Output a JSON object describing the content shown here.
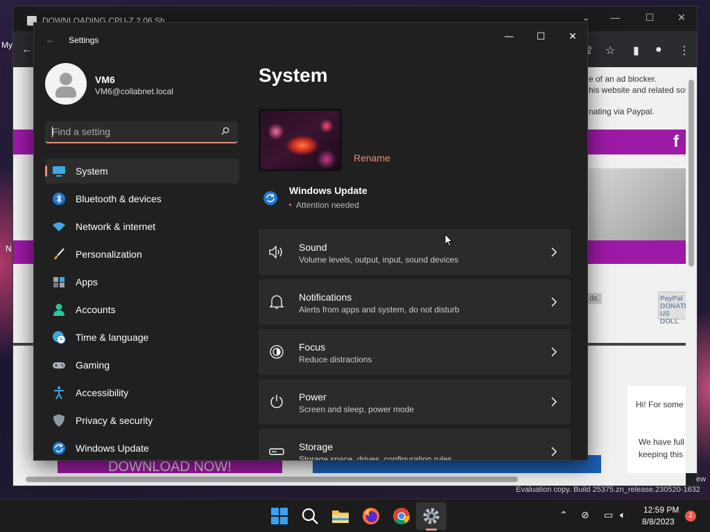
{
  "desktop": {
    "labels": [
      "My",
      "N"
    ]
  },
  "browser": {
    "tab_title": "DOWNLOADING CPU-Z 2.06 Sh...",
    "page_texts": [
      "e of an ad blocker.",
      "his website and related sof",
      "nating via Paypal.",
      "ds.",
      "Hi! For some",
      "We have full",
      "keeping this",
      "DOWNLOAD NOW!",
      "PayPal DONATE US DOLL"
    ],
    "facebook_letter": "f",
    "evaluation_text": "Evaluation copy. Build 25375.zn_release.230520-1632",
    "edge_fragment": "ew"
  },
  "settings": {
    "app_title": "Settings",
    "profile": {
      "name": "VM6",
      "email": "VM6@collabnet.local"
    },
    "search": {
      "placeholder": "Find a setting"
    },
    "nav": [
      {
        "label": "System",
        "icon": "system-icon",
        "active": true
      },
      {
        "label": "Bluetooth & devices",
        "icon": "bluetooth-icon"
      },
      {
        "label": "Network & internet",
        "icon": "wifi-icon"
      },
      {
        "label": "Personalization",
        "icon": "brush-icon"
      },
      {
        "label": "Apps",
        "icon": "apps-icon"
      },
      {
        "label": "Accounts",
        "icon": "person-icon"
      },
      {
        "label": "Time & language",
        "icon": "globe-clock-icon"
      },
      {
        "label": "Gaming",
        "icon": "gamepad-icon"
      },
      {
        "label": "Accessibility",
        "icon": "accessibility-icon"
      },
      {
        "label": "Privacy & security",
        "icon": "shield-icon"
      },
      {
        "label": "Windows Update",
        "icon": "update-icon"
      }
    ],
    "page_title": "System",
    "rename_label": "Rename",
    "windows_update": {
      "title": "Windows Update",
      "status": "Attention needed"
    },
    "cards": [
      {
        "title": "Sound",
        "subtitle": "Volume levels, output, input, sound devices",
        "icon": "speaker-icon"
      },
      {
        "title": "Notifications",
        "subtitle": "Alerts from apps and system, do not disturb",
        "icon": "bell-icon"
      },
      {
        "title": "Focus",
        "subtitle": "Reduce distractions",
        "icon": "focus-icon"
      },
      {
        "title": "Power",
        "subtitle": "Screen and sleep, power mode",
        "icon": "power-icon"
      },
      {
        "title": "Storage",
        "subtitle": "Storage space, drives, configuration rules",
        "icon": "storage-icon"
      }
    ]
  },
  "taskbar": {
    "time": "12:59 PM",
    "date": "8/8/2023",
    "notification_count": "2"
  },
  "colors": {
    "accent": "#e98f7a",
    "window_bg": "#202020",
    "card_bg": "#2b2b2b",
    "purple_bar": "#9c1aa6"
  }
}
